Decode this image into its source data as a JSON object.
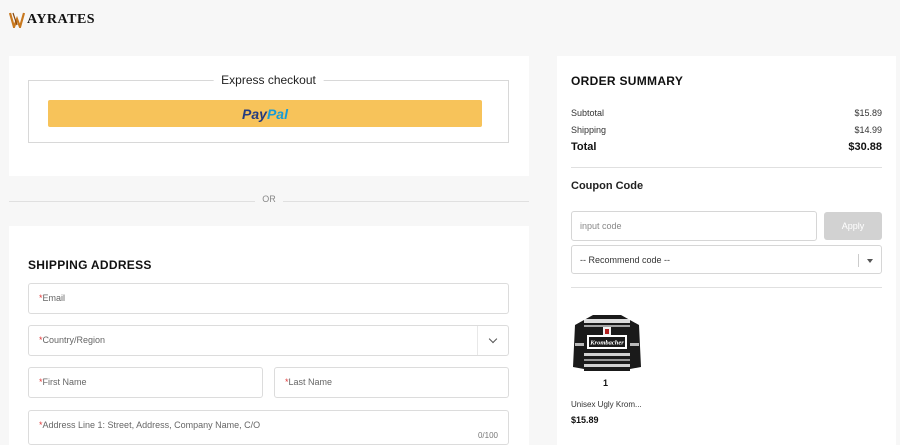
{
  "header": {
    "logo_text": "AYRATES"
  },
  "express": {
    "title": "Express checkout",
    "paypal_part1": "Pay",
    "paypal_part2": "Pal"
  },
  "divider": {
    "or_text": "OR"
  },
  "shipping": {
    "title": "SHIPPING ADDRESS",
    "required_mark": "*",
    "email_label": "Email",
    "country_label": "Country/Region",
    "first_name_label": "First Name",
    "last_name_label": "Last Name",
    "address_label": "Address Line 1: Street, Address, Company Name, C/O",
    "address_counter": "0/100"
  },
  "summary": {
    "title": "ORDER SUMMARY",
    "subtotal_label": "Subtotal",
    "subtotal_value": "$15.89",
    "shipping_label": "Shipping",
    "shipping_value": "$14.99",
    "total_label": "Total",
    "total_value": "$30.88",
    "coupon_title": "Coupon Code",
    "coupon_placeholder": "input code",
    "apply_label": "Apply",
    "recommend_label": "-- Recommend code --"
  },
  "product": {
    "quantity": "1",
    "name": "Unisex Ugly Krom...",
    "price": "$15.89",
    "image_text": "Krombacher"
  },
  "colors": {
    "paypal_yellow": "#f7c35a",
    "paypal_navy": "#253b80",
    "paypal_blue": "#179bd7",
    "logo_orange": "#c8781e",
    "required_red": "#e03a3a"
  }
}
